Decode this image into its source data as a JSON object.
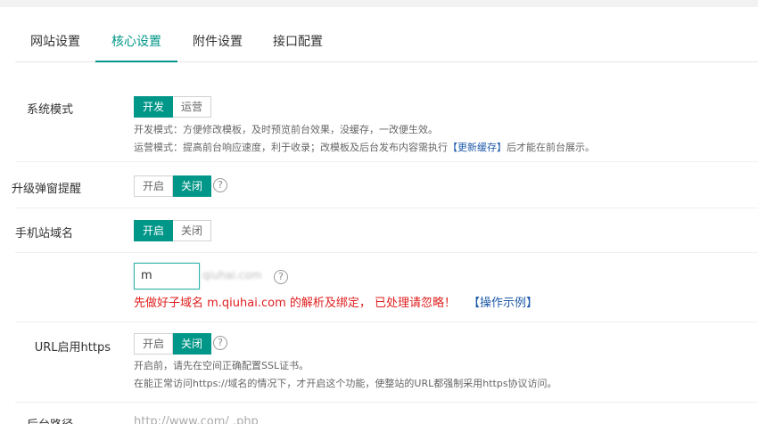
{
  "tabs": [
    {
      "label": "网站设置"
    },
    {
      "label": "核心设置"
    },
    {
      "label": "附件设置"
    },
    {
      "label": "接口配置"
    }
  ],
  "system_mode": {
    "label": "系统模式",
    "options": [
      "开发",
      "运营"
    ],
    "selected": "开发",
    "tip_dev": "开发模式：方便修改模板，及时预览前台效果，没缓存，一改便生效。",
    "tip_ops_prefix": "运营模式：提高前台响应速度，利于收录；改模板及后台发布内容需执行",
    "tip_ops_link": "【更新缓存】",
    "tip_ops_suffix": "后才能在前台展示。"
  },
  "upgrade_popup": {
    "label": "升级弹窗提醒",
    "options": [
      "开启",
      "关闭"
    ],
    "selected": "关闭",
    "help": "?"
  },
  "mobile_domain": {
    "label": "手机站域名",
    "options": [
      "开启",
      "关闭"
    ],
    "selected": "开启",
    "input_value": "m",
    "domain_suffix_blurred": "qiuhai.com",
    "help": "?",
    "warning": "先做好子域名 m.qiuhai.com 的解析及绑定， 已处理请忽略！",
    "warning_link": "【操作示例】"
  },
  "https": {
    "label": "URL启用https",
    "options": [
      "开启",
      "关闭"
    ],
    "selected": "关闭",
    "help": "?",
    "tip1": "开启前，请先在空间正确配置SSL证书。",
    "tip2": "在能正常访问https://域名的情况下，才开启这个功能，使整站的URL都强制采用https协议访问。"
  },
  "admin_path": {
    "label": "后台路径",
    "value": "http://www.com/ .php"
  },
  "colors": {
    "accent": "#009688",
    "warning": "#e01e1e",
    "link": "#1e5aa8"
  }
}
